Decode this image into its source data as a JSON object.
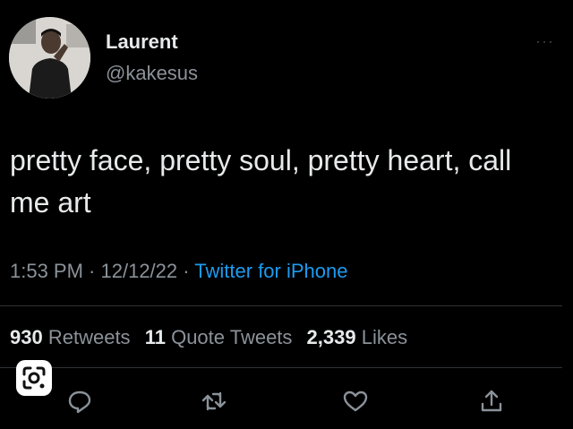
{
  "user": {
    "display_name": "Laurent",
    "handle": "@kakesus"
  },
  "tweet": {
    "text": "pretty face, pretty soul, pretty heart, call me art",
    "time": "1:53 PM",
    "date": "12/12/22",
    "source": "Twitter for iPhone",
    "separator": " · "
  },
  "stats": {
    "retweets_count": "930",
    "retweets_label": "Retweets",
    "quotes_count": "11",
    "quotes_label": "Quote Tweets",
    "likes_count": "2,339",
    "likes_label": "Likes"
  },
  "actions": [
    {
      "icon": "reply-icon"
    },
    {
      "icon": "retweet-icon"
    },
    {
      "icon": "like-icon"
    },
    {
      "icon": "share-icon"
    }
  ],
  "colors": {
    "background": "#000000",
    "text": "#e7e9ea",
    "muted": "#8b9299",
    "link": "#1d9bf0"
  }
}
